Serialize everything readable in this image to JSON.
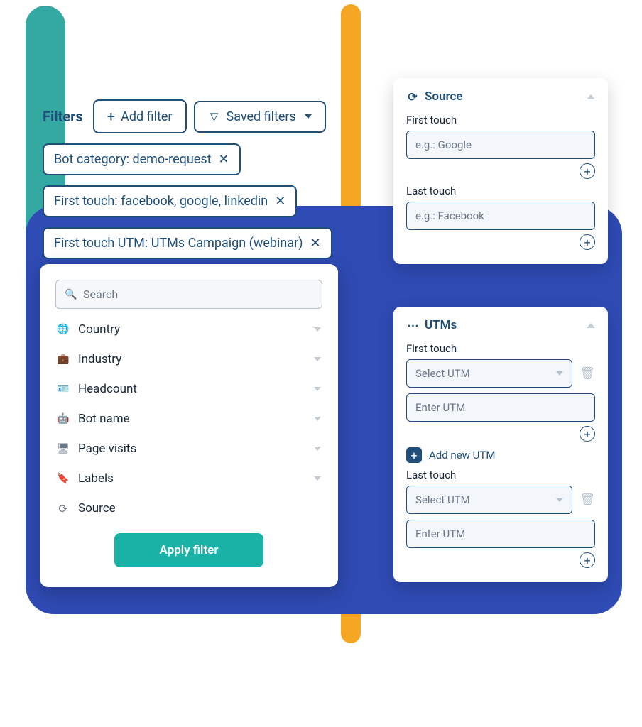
{
  "header": {
    "filters_label": "Filters",
    "add_filter_label": "Add filter",
    "saved_filters_label": "Saved filters"
  },
  "active_filters": [
    {
      "text": "Bot category: demo-request"
    },
    {
      "text": "First touch: facebook, google, linkedin"
    },
    {
      "text": "First touch UTM: UTMs Campaign (webinar)"
    }
  ],
  "filter_panel": {
    "search_placeholder": "Search",
    "apply_label": "Apply filter",
    "items": [
      {
        "label": "Country",
        "icon": "globe"
      },
      {
        "label": "Industry",
        "icon": "briefcase"
      },
      {
        "label": "Headcount",
        "icon": "idcard"
      },
      {
        "label": "Bot name",
        "icon": "robot"
      },
      {
        "label": "Page visits",
        "icon": "monitor"
      },
      {
        "label": "Labels",
        "icon": "tag"
      },
      {
        "label": "Source",
        "icon": "orbit"
      }
    ]
  },
  "source_card": {
    "title": "Source",
    "first_touch": {
      "label": "First touch",
      "placeholder": "e.g.: Google"
    },
    "last_touch": {
      "label": "Last touch",
      "placeholder": "e.g.: Facebook"
    }
  },
  "utms_card": {
    "title": "UTMs",
    "first_touch": {
      "label": "First touch",
      "select_placeholder": "Select UTM",
      "input_placeholder": "Enter UTM"
    },
    "add_new_utm": "Add new UTM",
    "last_touch": {
      "label": "Last touch",
      "select_placeholder": "Select UTM",
      "input_placeholder": "Enter UTM"
    }
  }
}
